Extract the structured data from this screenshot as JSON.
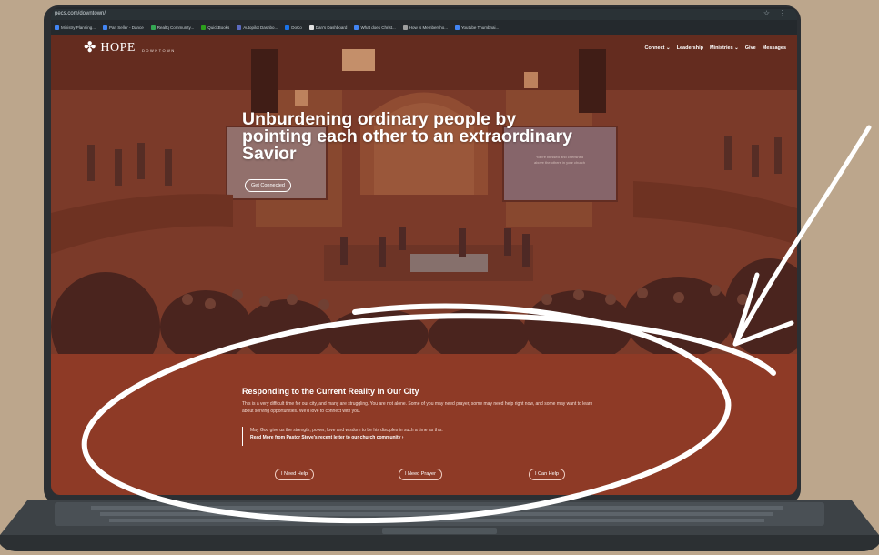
{
  "browser": {
    "url": "pecs.com/downtown/",
    "bookmarks": [
      {
        "label": "Ministry Planning...",
        "color": "#4285f4"
      },
      {
        "label": "Pan Seller - Dance",
        "color": "#4285f4"
      },
      {
        "label": "Realtq Community...",
        "color": "#34a853"
      },
      {
        "label": "QuickBooks",
        "color": "#2ca01c"
      },
      {
        "label": "Autopilot Dashbo...",
        "color": "#5c6bc0"
      },
      {
        "label": "DoCo",
        "color": "#1a73e8"
      },
      {
        "label": "Dan's Dashboard",
        "color": "#e0e0e0"
      },
      {
        "label": "What does Christ...",
        "color": "#4285f4"
      },
      {
        "label": "How is Membersho...",
        "color": "#9e9e9e"
      },
      {
        "label": "Youtube Thumbnai...",
        "color": "#4285f4"
      }
    ],
    "star_icon": "star-icon",
    "menu_icon": "more-icon"
  },
  "site": {
    "logo_word": "HOPE",
    "logo_sub": "DOWNTOWN",
    "nav": [
      "Connect ⌄",
      "Leadership",
      "Ministries ⌄",
      "Give",
      "Messages"
    ],
    "headline": "Unburdening ordinary people by pointing each other to an extraordinary Savior",
    "cta": "Get Connected",
    "panel": {
      "title": "Responding to the Current Reality in Our City",
      "body": "This is a very difficult time for our city, and many are struggling. You are not alone. Some of you may need prayer, some may need help right now, and some may want to learn about serving opportunities. We'd love to connect with you.",
      "quote": "May God give us the strength, power, love and wisdom to be his disciples in such a time as this.",
      "quote_link": "Read More from Pastor Steve's recent letter to our church community ›",
      "buttons": [
        "I Need Help",
        "I Need Prayer",
        "I Can Help"
      ]
    }
  },
  "colors": {
    "background": "#bca68c",
    "panel": "#8e3a26",
    "accent_white": "#ffffff"
  }
}
